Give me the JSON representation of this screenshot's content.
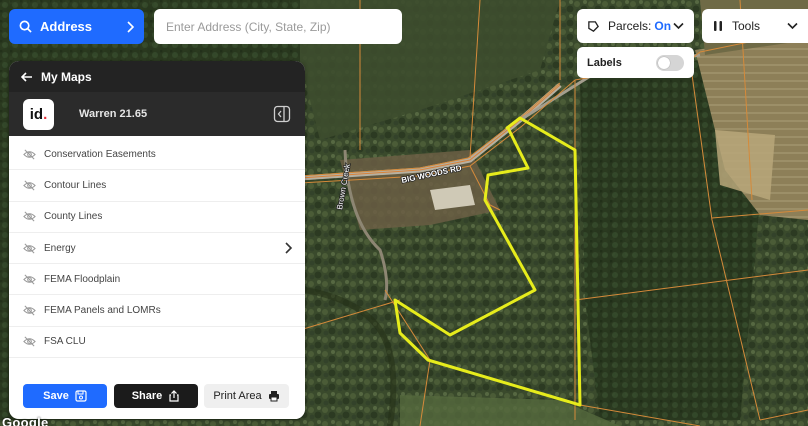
{
  "search": {
    "mode_label": "Address",
    "placeholder": "Enter Address (City, State, Zip)"
  },
  "parcels": {
    "label": "Parcels:",
    "state": "On"
  },
  "tools": {
    "label": "Tools"
  },
  "labels_toggle": {
    "label": "Labels",
    "enabled": false
  },
  "panel": {
    "back_label": "My Maps",
    "logo_text": "id",
    "map_name": "Warren 21.65",
    "layers": [
      {
        "label": "Conservation Easements",
        "has_submenu": false
      },
      {
        "label": "Contour Lines",
        "has_submenu": false
      },
      {
        "label": "County Lines",
        "has_submenu": false
      },
      {
        "label": "Energy",
        "has_submenu": true
      },
      {
        "label": "FEMA Floodplain",
        "has_submenu": false
      },
      {
        "label": "FEMA Panels and LOMRs",
        "has_submenu": false
      },
      {
        "label": "FSA CLU",
        "has_submenu": false
      }
    ],
    "actions": {
      "save": "Save",
      "share": "Share",
      "print": "Print Area"
    }
  },
  "map": {
    "road_labels": [
      "BIG WOODS RD",
      "Brown Creek"
    ],
    "attribution": "Google",
    "colors": {
      "boundary": "#e6ec1c",
      "parcel_lines": "#d58a3a",
      "accent": "#1f6bff"
    }
  }
}
